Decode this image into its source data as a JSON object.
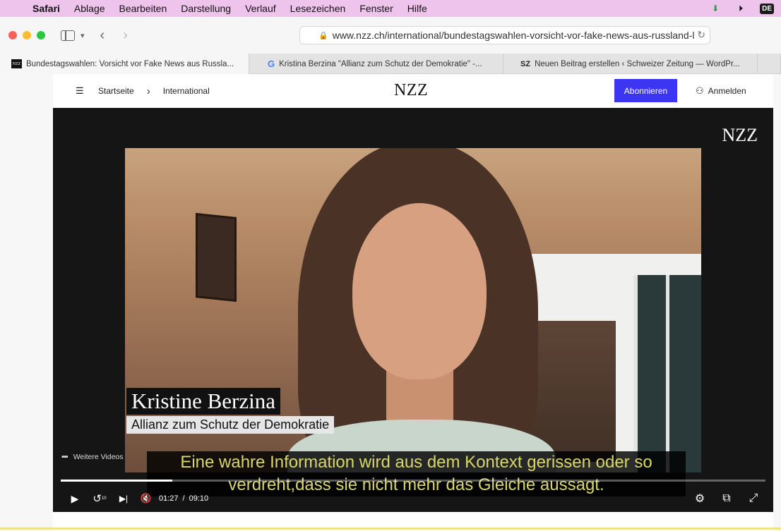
{
  "menubar": {
    "app_name": "Safari",
    "items": [
      "Ablage",
      "Bearbeiten",
      "Darstellung",
      "Verlauf",
      "Lesezeichen",
      "Fenster",
      "Hilfe"
    ],
    "language_badge": "DE"
  },
  "toolbar": {
    "url": "www.nzz.ch/international/bundestagswahlen-vorsicht-vor-fake-news-aus-russland-l"
  },
  "tabs": [
    {
      "favicon": "NZZ",
      "title": "Bundestagswahlen: Vorsicht vor Fake News aus Russla..."
    },
    {
      "favicon": "G",
      "title": "Kristina Berzina \"Allianz zum Schutz der Demokratie\" -..."
    },
    {
      "favicon": "SZ",
      "title": "Neuen Beitrag erstellen ‹ Schweizer Zeitung — WordPr..."
    }
  ],
  "header": {
    "breadcrumb": {
      "home": "Startseite",
      "section": "International"
    },
    "logo": "NZZ",
    "subscribe_label": "Abonnieren",
    "login_label": "Anmelden"
  },
  "player": {
    "watermark": "NZZ",
    "lower_third_name": "Kristine Berzina",
    "lower_third_org": "Allianz zum Schutz der Demokratie",
    "more_videos_label": "Weitere Videos",
    "subtitle_line1": "Eine wahre Information wird aus dem Kontext gerissen oder so",
    "subtitle_line2": "verdreht,dass sie nicht mehr das Gleiche aussagt.",
    "current_time": "01:27",
    "time_separator": "/",
    "duration": "09:10",
    "replay_seconds": "10",
    "progress_fraction": 0.158
  },
  "colors": {
    "menubar_bg": "#eec3ec",
    "subscribe_bg": "#3c35f2",
    "subtitle_text": "#d9d66a"
  },
  "icons": {
    "apple": "apple-icon",
    "download": "download-icon",
    "play_circle": "play-circle-icon",
    "sidebar": "sidebar-icon",
    "back": "chevron-left-icon",
    "forward": "chevron-right-icon",
    "lock": "lock-icon",
    "reload": "reload-icon",
    "menu": "menu-search-icon",
    "user": "user-icon",
    "grid": "grid-icon",
    "play": "play-icon",
    "replay": "replay-10-icon",
    "next": "skip-next-icon",
    "mute": "mute-icon",
    "settings": "gear-icon",
    "pip": "picture-in-picture-icon",
    "fullscreen": "fullscreen-icon"
  }
}
